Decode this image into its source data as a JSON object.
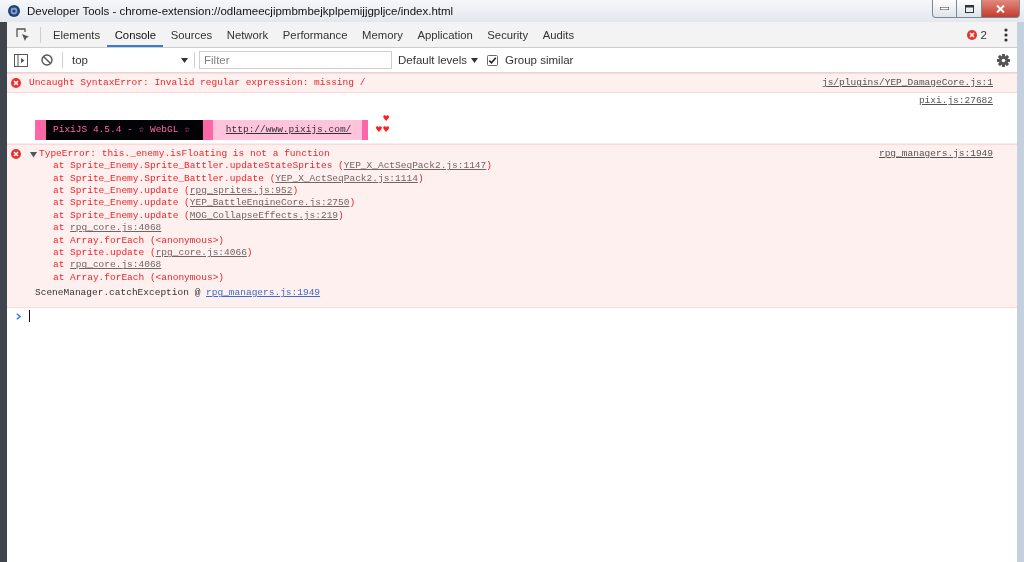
{
  "window": {
    "title": "Developer Tools - chrome-extension://odlameecjipmbmbejkplpemijjgpljce/index.html"
  },
  "tabs": [
    {
      "label": "Elements",
      "selected": false
    },
    {
      "label": "Console",
      "selected": true
    },
    {
      "label": "Sources",
      "selected": false
    },
    {
      "label": "Network",
      "selected": false
    },
    {
      "label": "Performance",
      "selected": false
    },
    {
      "label": "Memory",
      "selected": false
    },
    {
      "label": "Application",
      "selected": false
    },
    {
      "label": "Security",
      "selected": false
    },
    {
      "label": "Audits",
      "selected": false
    }
  ],
  "error_count": "2",
  "toolbar": {
    "context": "top",
    "filter": {
      "placeholder": "Filter"
    },
    "levels": "Default levels",
    "group_similar": {
      "label": "Group similar",
      "checked": true
    }
  },
  "messages": [
    {
      "kind": "error",
      "text": "Uncaught SyntaxError: Invalid regular expression: missing /",
      "source": "js/plugins/YEP_DamageCore.js:1"
    },
    {
      "kind": "banner",
      "source": "pixi.js:27682",
      "segments": [
        {
          "kind": "stripe"
        },
        {
          "kind": "label",
          "text": "PixiJS 4.5.4 - ☆ WebGL ☆"
        },
        {
          "kind": "stripe"
        },
        {
          "kind": "link",
          "text": "http://www.pixijs.com/"
        },
        {
          "kind": "stripe"
        }
      ],
      "raised_heart": "♥",
      "hearts": "♥♥"
    },
    {
      "kind": "stack_error",
      "expanded": true,
      "text": "TypeError: this._enemy.isFloating is not a function",
      "source": "rpg_managers.js:1949",
      "frames": [
        {
          "text": "at Sprite_Enemy.Sprite_Battler.updateStateSprites (",
          "link": "YEP_X_ActSeqPack2.js:1147",
          "after": ")"
        },
        {
          "text": "at Sprite_Enemy.Sprite_Battler.update (",
          "link": "YEP_X_ActSeqPack2.js:1114",
          "after": ")"
        },
        {
          "text": "at Sprite_Enemy.update (",
          "link": "rpg_sprites.js:952",
          "after": ")"
        },
        {
          "text": "at Sprite_Enemy.update (",
          "link": "YEP_BattleEngineCore.js:2750",
          "after": ")"
        },
        {
          "text": "at Sprite_Enemy.update (",
          "link": "MOG_CollapseEffects.js:219",
          "after": ")"
        },
        {
          "text": "at ",
          "link": "rpg_core.js:4068"
        },
        {
          "text": "at Array.forEach (<anonymous>)"
        },
        {
          "text": "at Sprite.update (",
          "link": "rpg_core.js:4066",
          "after": ")"
        },
        {
          "text": "at ",
          "link": "rpg_core.js:4068"
        },
        {
          "text": "at Array.forEach (<anonymous>)"
        }
      ],
      "caller": {
        "text": "SceneManager.catchException @ ",
        "link": "rpg_managers.js:1949"
      }
    }
  ]
}
